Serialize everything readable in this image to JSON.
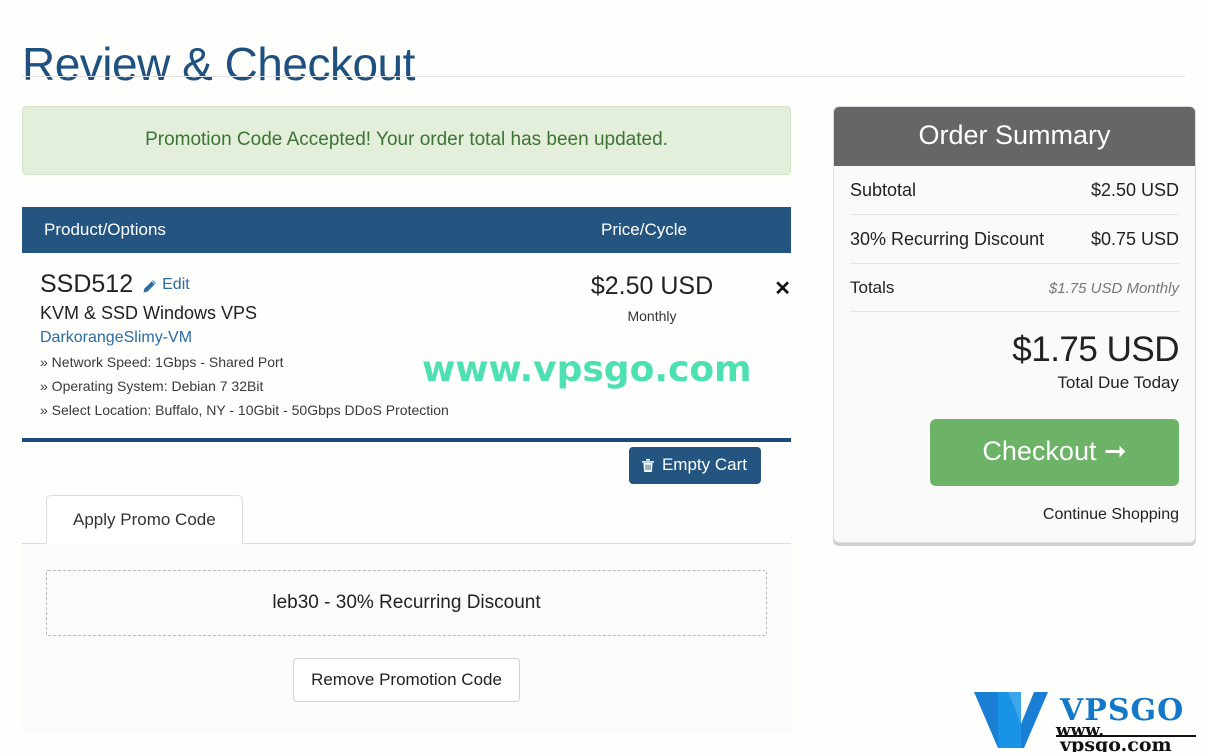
{
  "page": {
    "title": "Review & Checkout"
  },
  "alert": {
    "message": "Promotion Code Accepted! Your order total has been updated.",
    "bg_color": "#e3eedb",
    "text_color": "#3b7434"
  },
  "cart": {
    "columns": {
      "product": "Product/Options",
      "price": "Price/Cycle"
    },
    "header_color": "#245580",
    "items": [
      {
        "name": "SSD512",
        "edit_label": "Edit",
        "edit_icon": "pencil-icon",
        "description": "KVM & SSD Windows VPS",
        "domain": "DarkorangeSlimy-VM",
        "options": [
          "» Network Speed: 1Gbps - Shared Port",
          "» Operating System: Debian 7 32Bit",
          "» Select Location: Buffalo, NY - 10Gbit - 50Gbps DDoS Protection"
        ],
        "price": "$2.50 USD",
        "cycle": "Monthly",
        "remove_icon": "✕"
      }
    ],
    "empty_cart_label": "Empty Cart",
    "empty_cart_icon": "trash-icon"
  },
  "promo": {
    "tab_label": "Apply Promo Code",
    "applied_code": "leb30 - 30% Recurring Discount",
    "remove_label": "Remove Promotion Code"
  },
  "summary": {
    "title": "Order Summary",
    "header_color": "#666666",
    "rows": [
      {
        "label": "Subtotal",
        "value": "$2.50 USD"
      },
      {
        "label": "30% Recurring Discount",
        "value": "$0.75 USD"
      },
      {
        "label": "Totals",
        "value": "$1.75 USD Monthly"
      }
    ],
    "grand_total": "$1.75 USD",
    "grand_caption": "Total Due Today",
    "checkout_label": "Checkout",
    "checkout_arrow": "➜",
    "checkout_color": "#6cb367",
    "continue_label": "Continue Shopping"
  },
  "watermark": {
    "text": "www.vpsgo.com",
    "color": "#4ce0b3",
    "logo_brand": "VPSGO",
    "logo_www": "www.",
    "logo_domain": "vpsgo.com"
  }
}
